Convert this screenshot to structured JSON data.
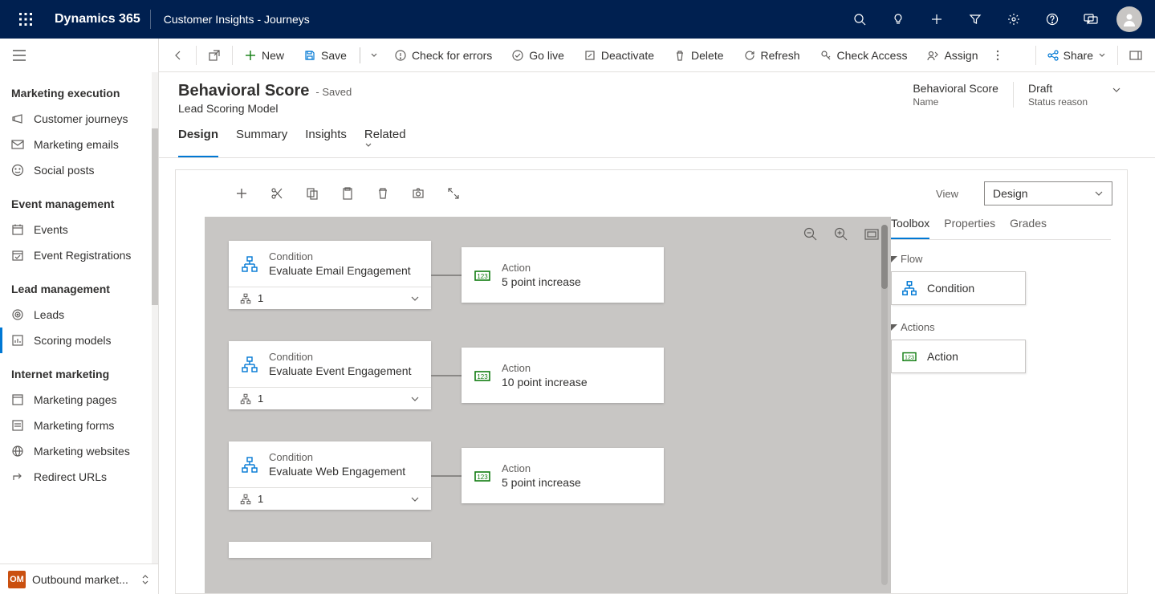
{
  "topnav": {
    "product": "Dynamics 365",
    "subtitle": "Customer Insights - Journeys"
  },
  "sidebar": {
    "groups": [
      {
        "title": "Marketing execution",
        "items": [
          {
            "icon": "megaphone",
            "label": "Customer journeys"
          },
          {
            "icon": "mail",
            "label": "Marketing emails"
          },
          {
            "icon": "smile",
            "label": "Social posts"
          }
        ]
      },
      {
        "title": "Event management",
        "items": [
          {
            "icon": "calendar",
            "label": "Events"
          },
          {
            "icon": "calendar-check",
            "label": "Event Registrations"
          }
        ]
      },
      {
        "title": "Lead management",
        "items": [
          {
            "icon": "target",
            "label": "Leads"
          },
          {
            "icon": "score",
            "label": "Scoring models",
            "active": true
          }
        ]
      },
      {
        "title": "Internet marketing",
        "items": [
          {
            "icon": "page",
            "label": "Marketing pages"
          },
          {
            "icon": "form",
            "label": "Marketing forms"
          },
          {
            "icon": "globe",
            "label": "Marketing websites"
          },
          {
            "icon": "redirect",
            "label": "Redirect URLs"
          }
        ]
      }
    ],
    "footer": {
      "badge": "OM",
      "label": "Outbound market..."
    }
  },
  "cmdbar": {
    "new": "New",
    "save": "Save",
    "check": "Check for errors",
    "golive": "Go live",
    "deactivate": "Deactivate",
    "delete": "Delete",
    "refresh": "Refresh",
    "checkaccess": "Check Access",
    "assign": "Assign",
    "share": "Share"
  },
  "record": {
    "title": "Behavioral Score",
    "saved": "- Saved",
    "subtitle": "Lead Scoring Model",
    "fields": [
      {
        "value": "Behavioral Score",
        "label": "Name"
      },
      {
        "value": "Draft",
        "label": "Status reason"
      }
    ]
  },
  "tabs": [
    "Design",
    "Summary",
    "Insights",
    "Related"
  ],
  "designer": {
    "viewLabel": "View",
    "viewValue": "Design",
    "flows": [
      {
        "cond_type": "Condition",
        "cond_name": "Evaluate Email Engagement",
        "cond_count": "1",
        "action_type": "Action",
        "action_name": "5 point increase"
      },
      {
        "cond_type": "Condition",
        "cond_name": "Evaluate Event Engagement",
        "cond_count": "1",
        "action_type": "Action",
        "action_name": "10 point increase"
      },
      {
        "cond_type": "Condition",
        "cond_name": "Evaluate Web Engagement",
        "cond_count": "1",
        "action_type": "Action",
        "action_name": "5 point increase"
      }
    ],
    "toolbox": {
      "tabs": [
        "Toolbox",
        "Properties",
        "Grades"
      ],
      "flow_title": "Flow",
      "flow_item": "Condition",
      "actions_title": "Actions",
      "actions_item": "Action"
    }
  }
}
